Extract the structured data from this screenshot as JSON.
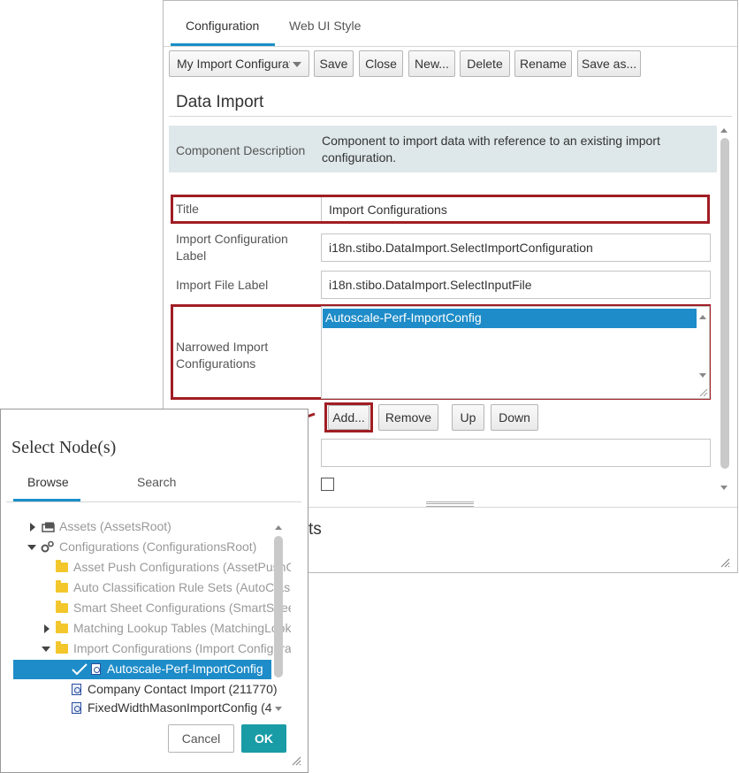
{
  "config_panel": {
    "tabs": [
      {
        "label": "Configuration",
        "active": true
      },
      {
        "label": "Web UI Style",
        "active": false
      }
    ],
    "config_select": {
      "value": "My Import Configurations"
    },
    "toolbar": {
      "save_label": "Save",
      "close_label": "Close",
      "new_label": "New...",
      "delete_label": "Delete",
      "rename_label": "Rename",
      "save_as_label": "Save as..."
    },
    "section_title": "Data Import",
    "component_description": {
      "label": "Component Description",
      "value": "Component to import data with reference to an existing import configuration."
    },
    "fields": {
      "title": {
        "label": "Title",
        "value": "Import Configurations"
      },
      "import_config_label": {
        "label": "Import Configuration Label",
        "value": "i18n.stibo.DataImport.SelectImportConfiguration"
      },
      "import_file_label": {
        "label": "Import File Label",
        "value": "i18n.stibo.DataImport.SelectInputFile"
      },
      "narrowed": {
        "label": "Narrowed Import Configurations",
        "items": [
          "Autoscale-Perf-ImportConfig"
        ]
      }
    },
    "list_buttons": {
      "add_label": "Add...",
      "remove_label": "Remove",
      "up_label": "Up",
      "down_label": "Down"
    },
    "bottom_partial_text": "ts"
  },
  "dialog": {
    "title": "Select Node(s)",
    "tabs": [
      {
        "label": "Browse",
        "active": true
      },
      {
        "label": "Search",
        "active": false
      }
    ],
    "tree": [
      {
        "label": "Assets (AssetsRoot)",
        "expander": "collapsed",
        "icon": "assets-icon"
      },
      {
        "label": "Configurations (ConfigurationsRoot)",
        "expander": "expanded",
        "icon": "gears-icon"
      },
      {
        "label": "Asset Push Configurations (AssetPushConfigurations)",
        "expander": "none",
        "icon": "folder-icon"
      },
      {
        "label": "Auto Classification Rule Sets (AutoClassificationRuleSets)",
        "expander": "none",
        "icon": "folder-icon"
      },
      {
        "label": "Smart Sheet Configurations (SmartSheetConfigurations)",
        "expander": "none",
        "icon": "folder-icon"
      },
      {
        "label": "Matching Lookup Tables (MatchingLookupTables)",
        "expander": "collapsed",
        "icon": "folder-icon"
      },
      {
        "label": "Import Configurations (Import Configurations)",
        "expander": "expanded",
        "icon": "folder-icon"
      },
      {
        "label": "Autoscale-Perf-ImportConfig",
        "expander": "none",
        "icon": "import-config-icon",
        "selected": true
      },
      {
        "label": "Company Contact Import (211770)",
        "expander": "none",
        "icon": "import-config-icon"
      },
      {
        "label": "FixedWidthMasonImportConfig (4",
        "expander": "none",
        "icon": "import-config-icon"
      }
    ],
    "cancel_label": "Cancel",
    "ok_label": "OK"
  },
  "colors": {
    "accent_blue": "#1e8cc8",
    "highlight_red": "#a01e24",
    "ok_teal": "#199ca6",
    "description_bg": "#dee7ea"
  }
}
